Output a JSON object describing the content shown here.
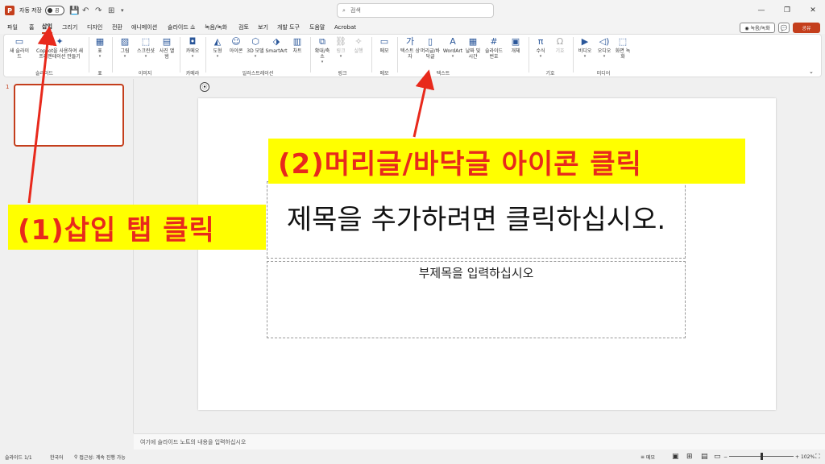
{
  "titlebar": {
    "autosave": "자동 저장",
    "toggle_state": "끔",
    "search_placeholder": "검색"
  },
  "tabs": [
    "파일",
    "홈",
    "삽입",
    "그리기",
    "디자인",
    "전환",
    "애니메이션",
    "슬라이드 쇼",
    "녹음/녹화",
    "검토",
    "보기",
    "개발 도구",
    "도움말",
    "Acrobat"
  ],
  "active_tab": "삽입",
  "right_buttons": {
    "record": "◉ 녹음/녹화",
    "share": "공유"
  },
  "ribbon": {
    "new_slide": "새 슬라이드",
    "copilot": "Copilot을 사용하여 새 프레젠테이션 만들기",
    "table": "표",
    "image": "그림",
    "screenshot": "스크린샷",
    "photo_album": "사진 앨범",
    "cameo": "카메오",
    "shapes": "도형",
    "icons": "아이콘",
    "model3d": "3D 모델",
    "smartart": "SmartArt",
    "chart": "차트",
    "zoom": "확대/축소",
    "link": "링크",
    "action": "실행",
    "comment": "메모",
    "textbox": "텍스트 상자",
    "header_footer": "머리글/바닥글",
    "wordart": "WordArt",
    "datetime": "날짜 및 시간",
    "slide_number": "슬라이드 번호",
    "object": "개체",
    "equation": "수식",
    "symbol": "기호",
    "video": "비디오",
    "audio": "오디오",
    "screen_record": "화면 녹화",
    "groups": {
      "slides": "슬라이드",
      "tables": "표",
      "images": "이미지",
      "camera": "카메라",
      "illustrations": "일러스트레이션",
      "links": "링크",
      "comments": "메모",
      "text": "텍스트",
      "symbols": "기호",
      "media": "미디어"
    }
  },
  "slide_pane": {
    "number": "1"
  },
  "slide": {
    "title_placeholder": "제목을 추가하려면 클릭하십시오.",
    "subtitle_placeholder": "부제목을 입력하십시오"
  },
  "notes": "여기에 슬라이드 노트의 내용을 입력하십시오",
  "status": {
    "slide_count": "슬라이드 1/1",
    "language": "한국어",
    "accessibility": "접근성: 계속 진행 가능",
    "notes_btn": "메모",
    "zoom": "102%"
  },
  "annotations": {
    "step1": "(1)삽입 탭 클릭",
    "step2": "(2)머리글/바닥글 아이콘 클릭"
  },
  "colors": {
    "accent": "#c43e1c",
    "callout_bg": "#ffff00",
    "callout_text": "#e8291c"
  }
}
